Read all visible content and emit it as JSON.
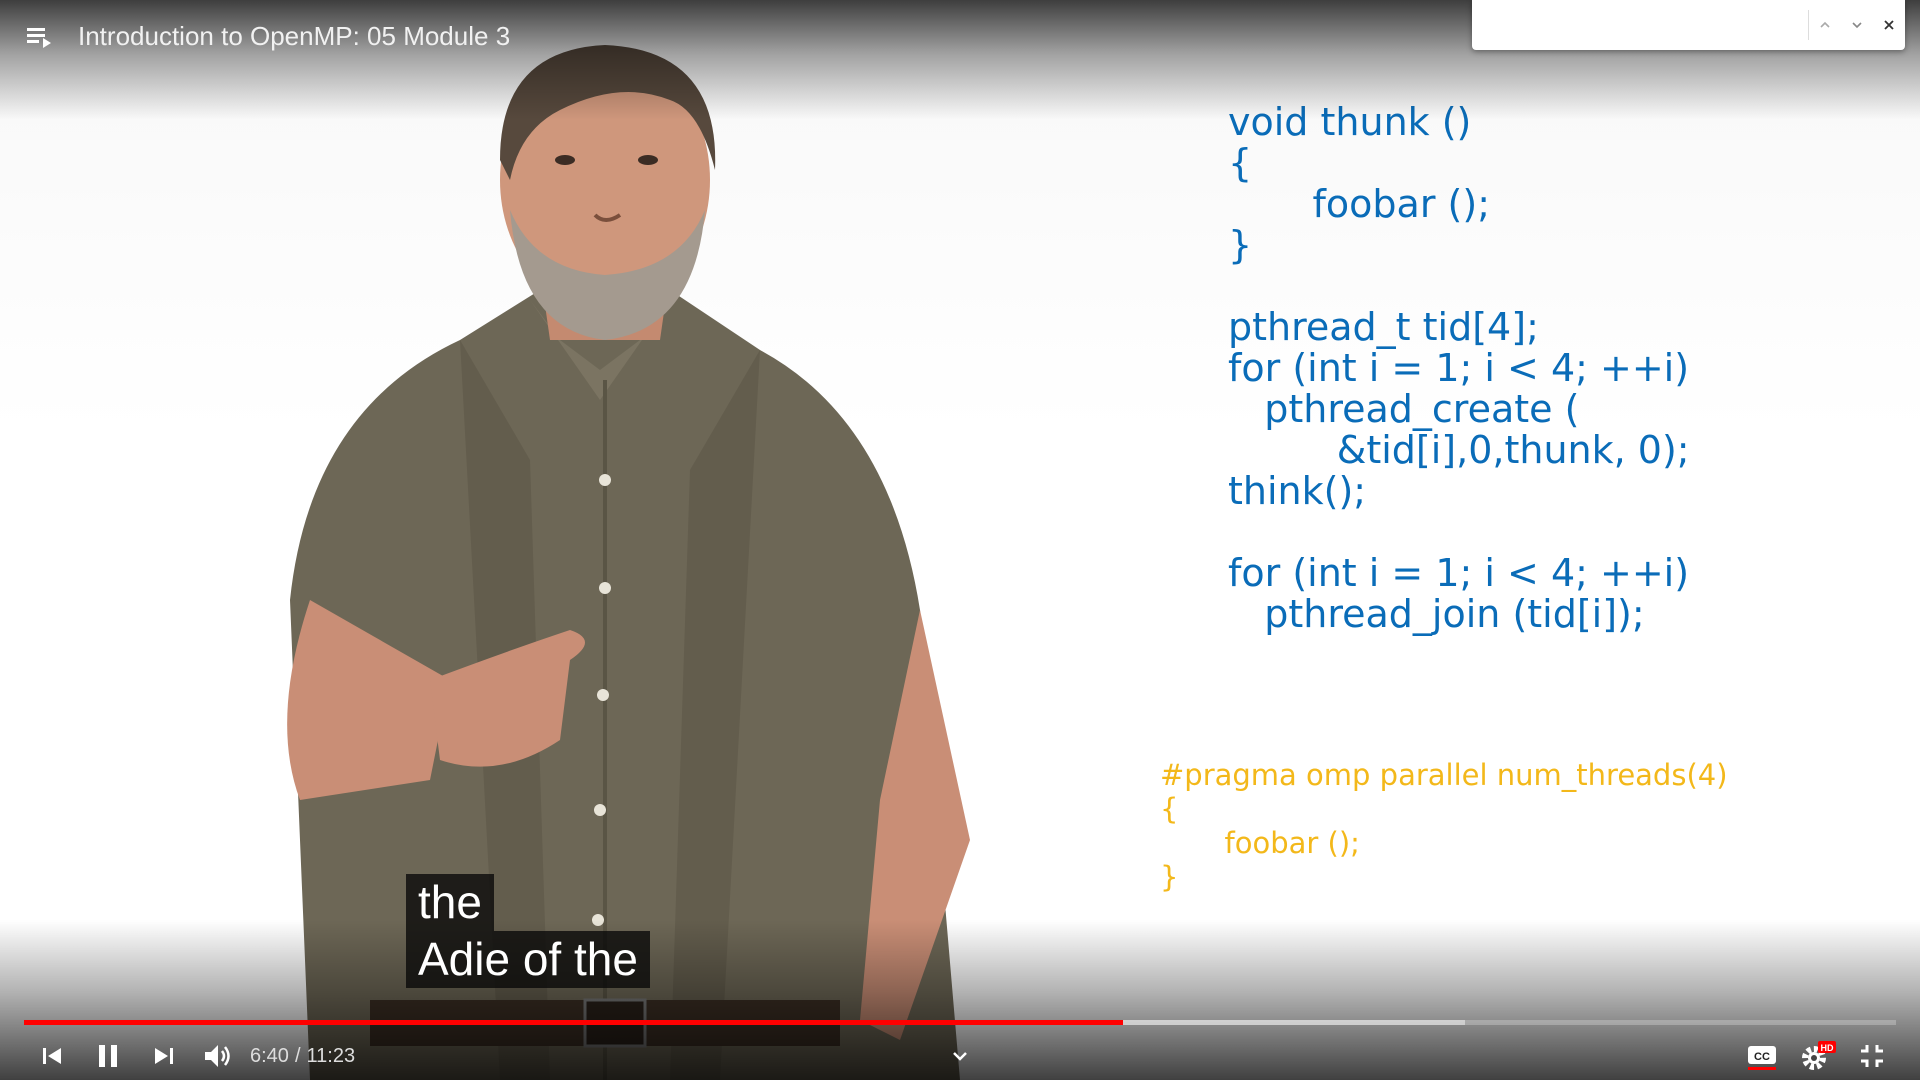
{
  "video": {
    "title": "Introduction to OpenMP: 05 Module 3",
    "current_time": "6:40",
    "separator": "/",
    "duration": "11:23",
    "progress_played_fraction": 0.587,
    "progress_buffered_fraction": 0.77
  },
  "find_bar": {
    "value": "",
    "placeholder": ""
  },
  "slide": {
    "code_blue": "void thunk ()\n{\n       foobar ();\n}\n\npthread_t tid[4];\nfor (int i = 1; i < 4; ++i)\n   pthread_create (\n         &tid[i],0,thunk, 0);\nthink();\n\nfor (int i = 1; i < 4; ++i)\n   pthread_join (tid[i]);",
    "code_yellow": "#pragma omp parallel num_threads(4)\n{\n       foobar ();\n}"
  },
  "captions": [
    "the",
    "Adie of the"
  ],
  "colors": {
    "progress_played": "#ff0000",
    "code_blue": "#0a6cb8",
    "code_yellow": "#f3b81a"
  },
  "icons": {
    "playlist": "playlist-icon",
    "find_prev": "chevron-up-icon",
    "find_next": "chevron-down-icon",
    "find_close": "close-icon",
    "previous": "skip-previous-icon",
    "pause": "pause-icon",
    "next": "skip-next-icon",
    "volume": "volume-icon",
    "expand": "chevron-down-icon",
    "captions": "closed-captions-icon",
    "settings": "settings-gear-icon",
    "exit_fullscreen": "exit-fullscreen-icon"
  },
  "badges": {
    "hd": "HD"
  }
}
